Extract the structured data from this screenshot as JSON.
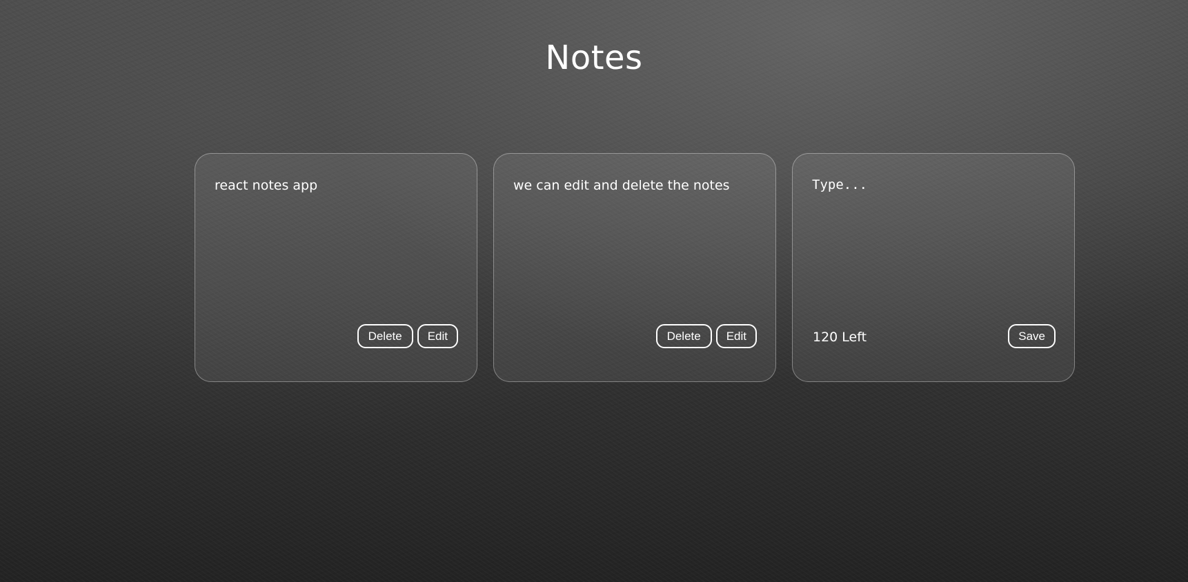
{
  "page": {
    "title": "Notes"
  },
  "notes": [
    {
      "text": "react notes app",
      "delete_label": "Delete",
      "edit_label": "Edit"
    },
    {
      "text": "we can edit and delete the notes",
      "delete_label": "Delete",
      "edit_label": "Edit"
    }
  ],
  "new_note": {
    "placeholder": "Type...",
    "value": "",
    "counter_text": "120 Left",
    "save_label": "Save"
  },
  "colors": {
    "text": "#ffffff",
    "card_border": "rgba(255,255,255,0.35)",
    "background_top": "#4a4a4a",
    "background_bottom": "#232323"
  }
}
